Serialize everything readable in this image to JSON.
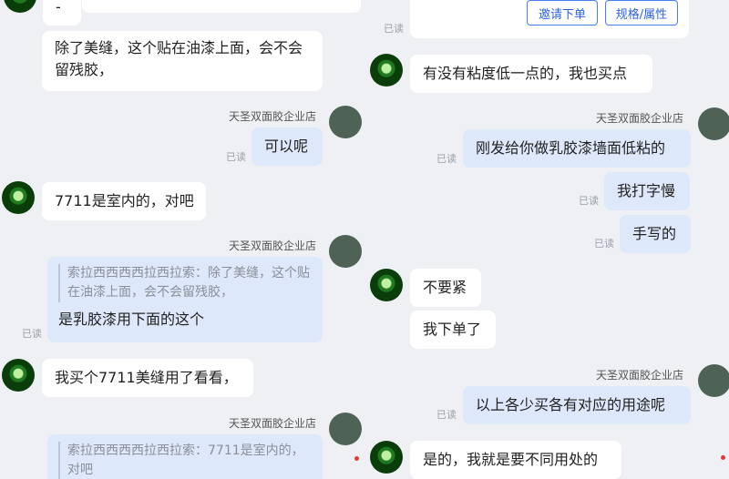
{
  "colors": {
    "bubble_sent": "#dde8fb",
    "bubble_received": "#ffffff",
    "accent": "#4a7ef0",
    "unread_dot": "#e53935"
  },
  "left": {
    "top_partial_text": "-",
    "msg1": "除了美缝，这个贴在油漆上面，会不会留残胶，",
    "shop1": "天圣双面胶企业店",
    "read1": "已读",
    "reply1": "可以呢",
    "msg2": "7711是室内的，对吧",
    "shop2": "天圣双面胶企业店",
    "quote1_text": "索拉西西西西拉西拉索：除了美缝，这个贴在油漆上面，会不会留残胶，",
    "quote1_reply": "是乳胶漆用下面的这个",
    "read2": "已读",
    "msg3": "我买个7711美缝用了看看，",
    "shop3": "天圣双面胶企业店",
    "quote2_text": "索拉西西西西拉西拉索：7711是室内的，对吧"
  },
  "right": {
    "read0": "已读",
    "invite_button": "邀请下单",
    "spec_button": "规格/属性",
    "msg1": "有没有粘度低一点的，我也买点",
    "shop1": "天圣双面胶企业店",
    "read1": "已读",
    "reply1": "刚发给你做乳胶漆墙面低粘的",
    "read2": "已读",
    "reply2": "我打字慢",
    "read3": "已读",
    "reply3": "手写的",
    "msg2": "不要紧",
    "msg3": "我下单了",
    "shop2": "天圣双面胶企业店",
    "read4": "已读",
    "reply4": "以上各少买各有对应的用途呢",
    "msg4": "是的，我就是要不同用处的"
  }
}
